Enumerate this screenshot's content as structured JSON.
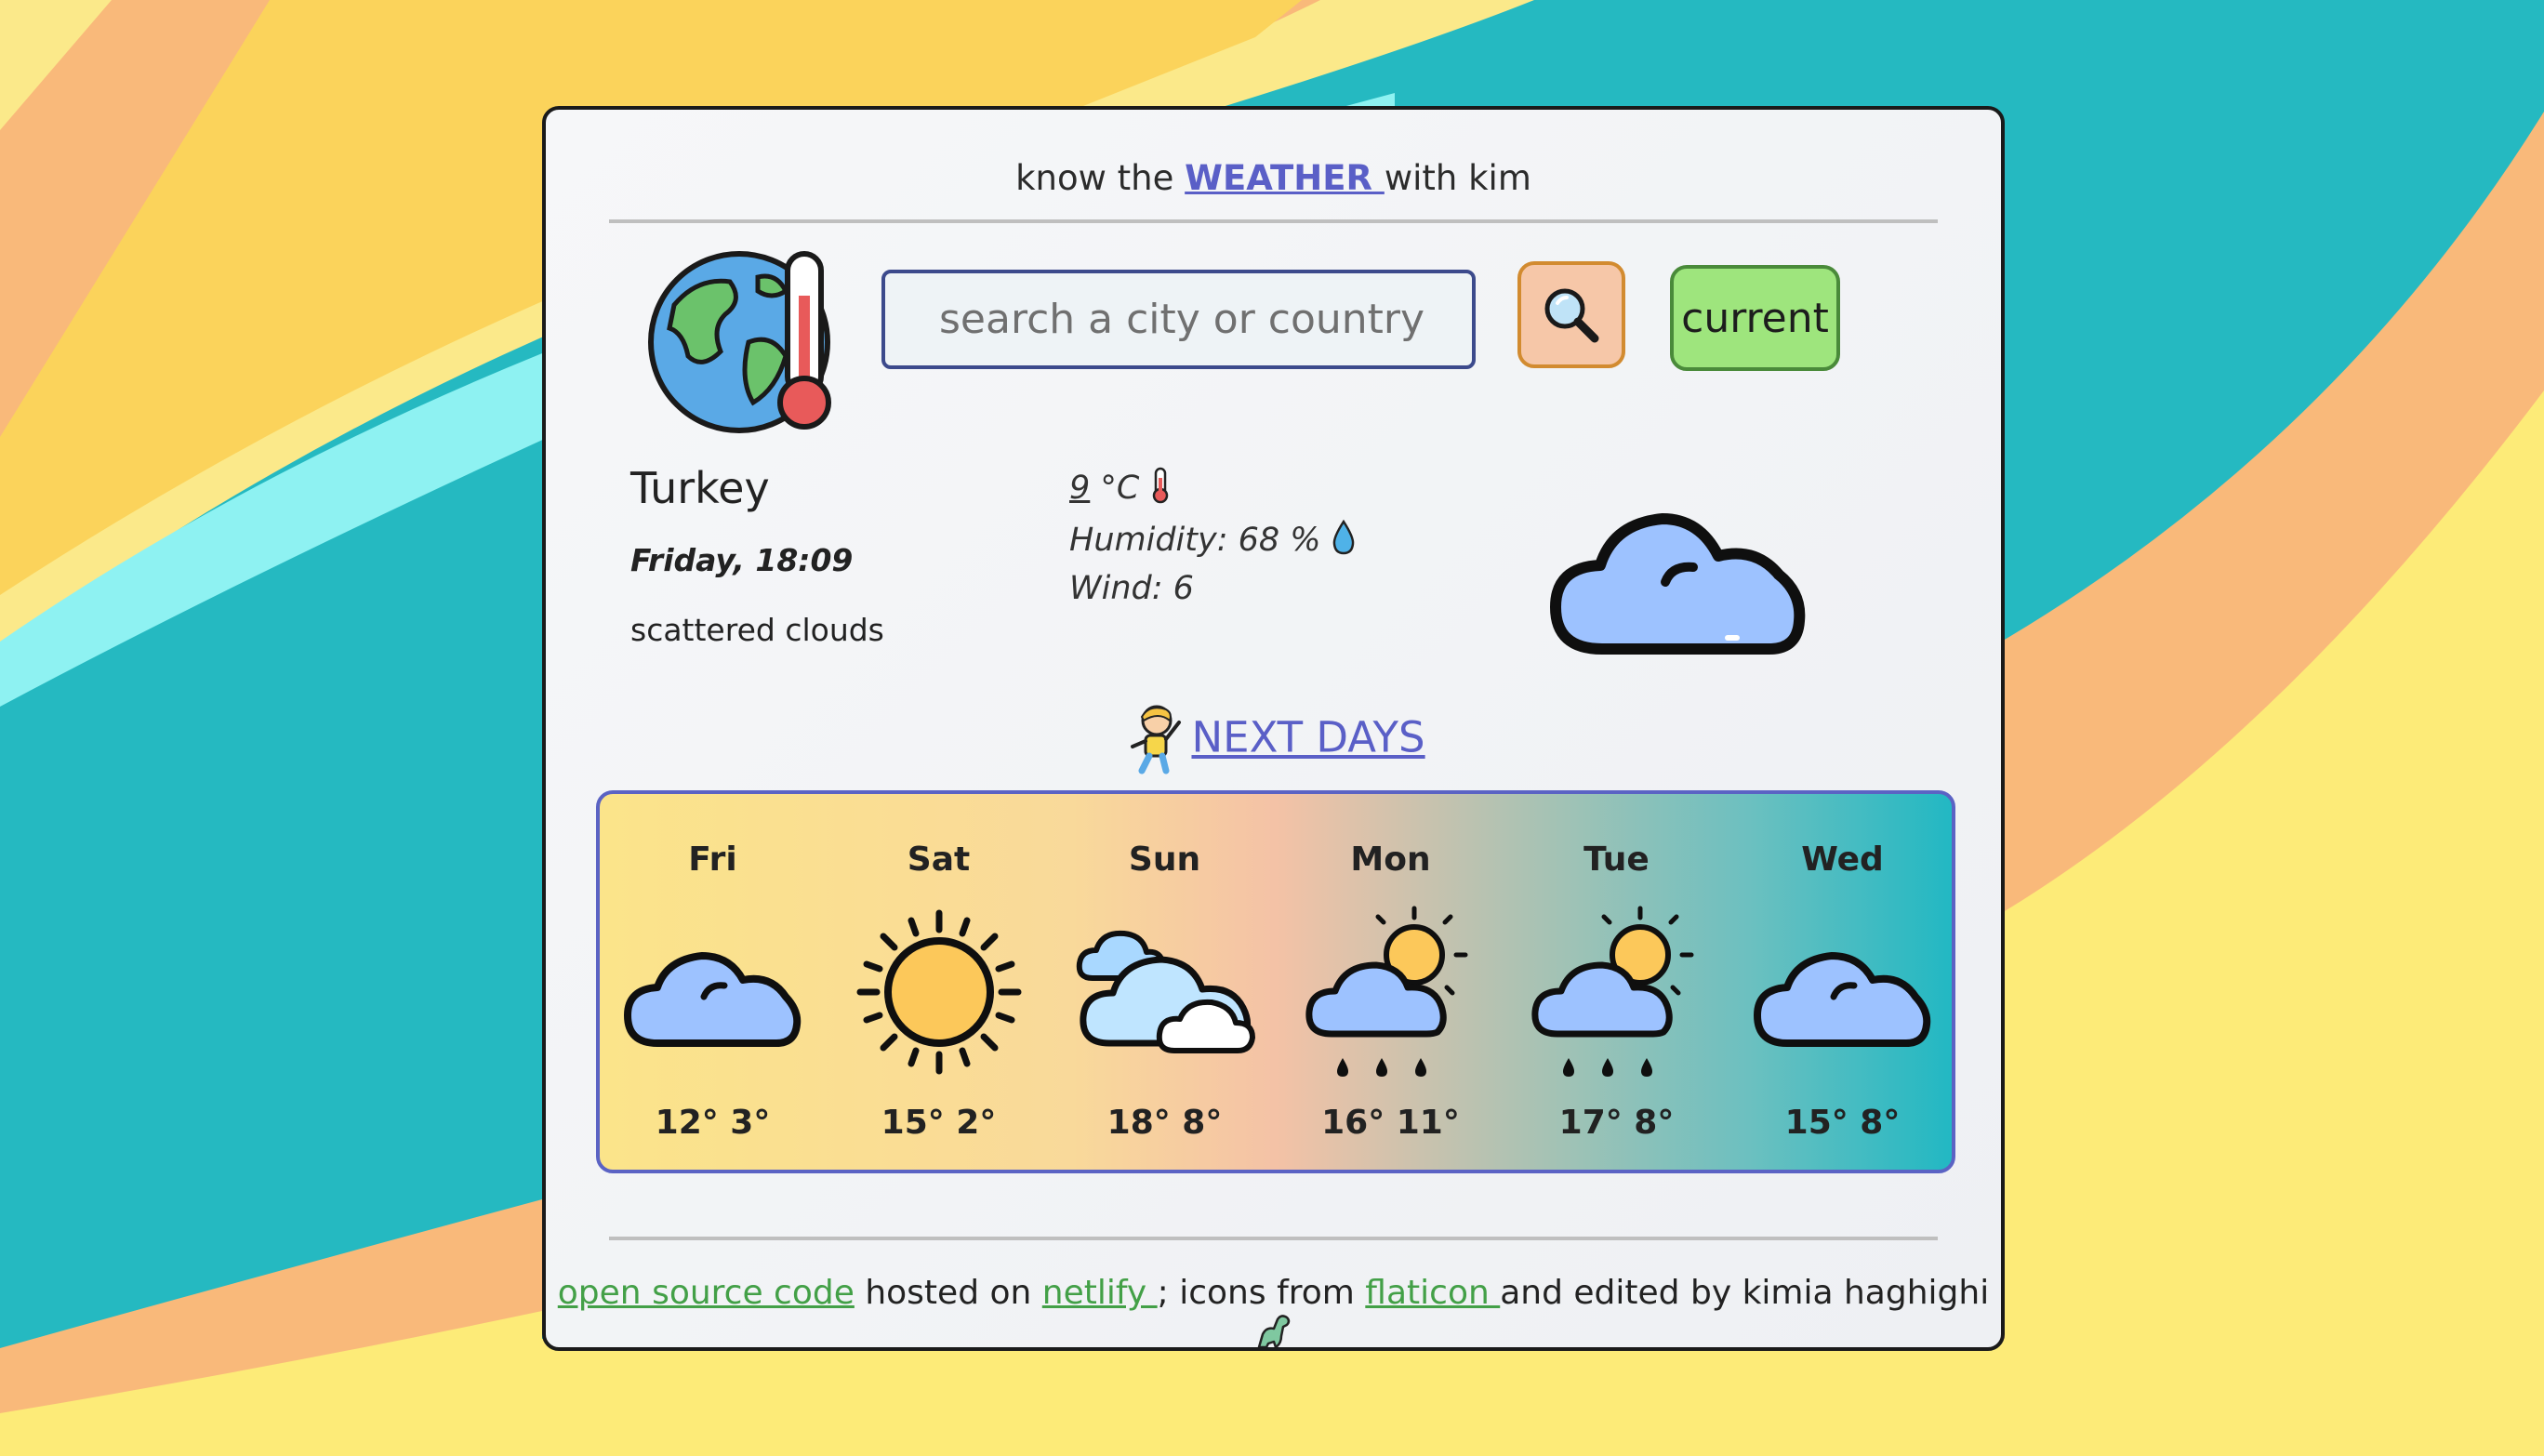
{
  "header": {
    "prefix": "know the",
    "link": "WEATHER ",
    "suffix": "with kim"
  },
  "search": {
    "placeholder": "search a city or country",
    "button_icon": "magnifier-icon",
    "current_label": "current"
  },
  "current": {
    "city": "Turkey",
    "date": "Friday, 18:09",
    "description": "scattered clouds",
    "temp": "9",
    "temp_unit": " °C",
    "humidity": "Humidity: 68 %",
    "wind": "Wind: 6",
    "icon": "cloud-icon"
  },
  "next_days": {
    "label": " NEXT DAYS",
    "icon": "kid-icon"
  },
  "forecast": [
    {
      "day": "Fri",
      "temps": "12° 3°",
      "icon": "cloud-icon"
    },
    {
      "day": "Sat",
      "temps": "15° 2°",
      "icon": "sun-icon"
    },
    {
      "day": "Sun",
      "temps": "18° 8°",
      "icon": "clouds-icon"
    },
    {
      "day": "Mon",
      "temps": "16° 11°",
      "icon": "sun-cloud-rain-icon"
    },
    {
      "day": "Tue",
      "temps": "17° 8°",
      "icon": "sun-cloud-rain-icon"
    },
    {
      "day": "Wed",
      "temps": "15° 8°",
      "icon": "cloud-icon"
    }
  ],
  "footer": {
    "code_link": "open source code",
    "hosted": " hosted on ",
    "host_link": "netlify ",
    "icons_from": "; icons from ",
    "icons_link": "flaticon ",
    "edited": "and edited by kimia haghighi"
  },
  "colors": {
    "accent": "#5a5fc7",
    "link_green": "#43a047",
    "current_button": "#9ee57d",
    "search_button": "#f6c7a8"
  }
}
